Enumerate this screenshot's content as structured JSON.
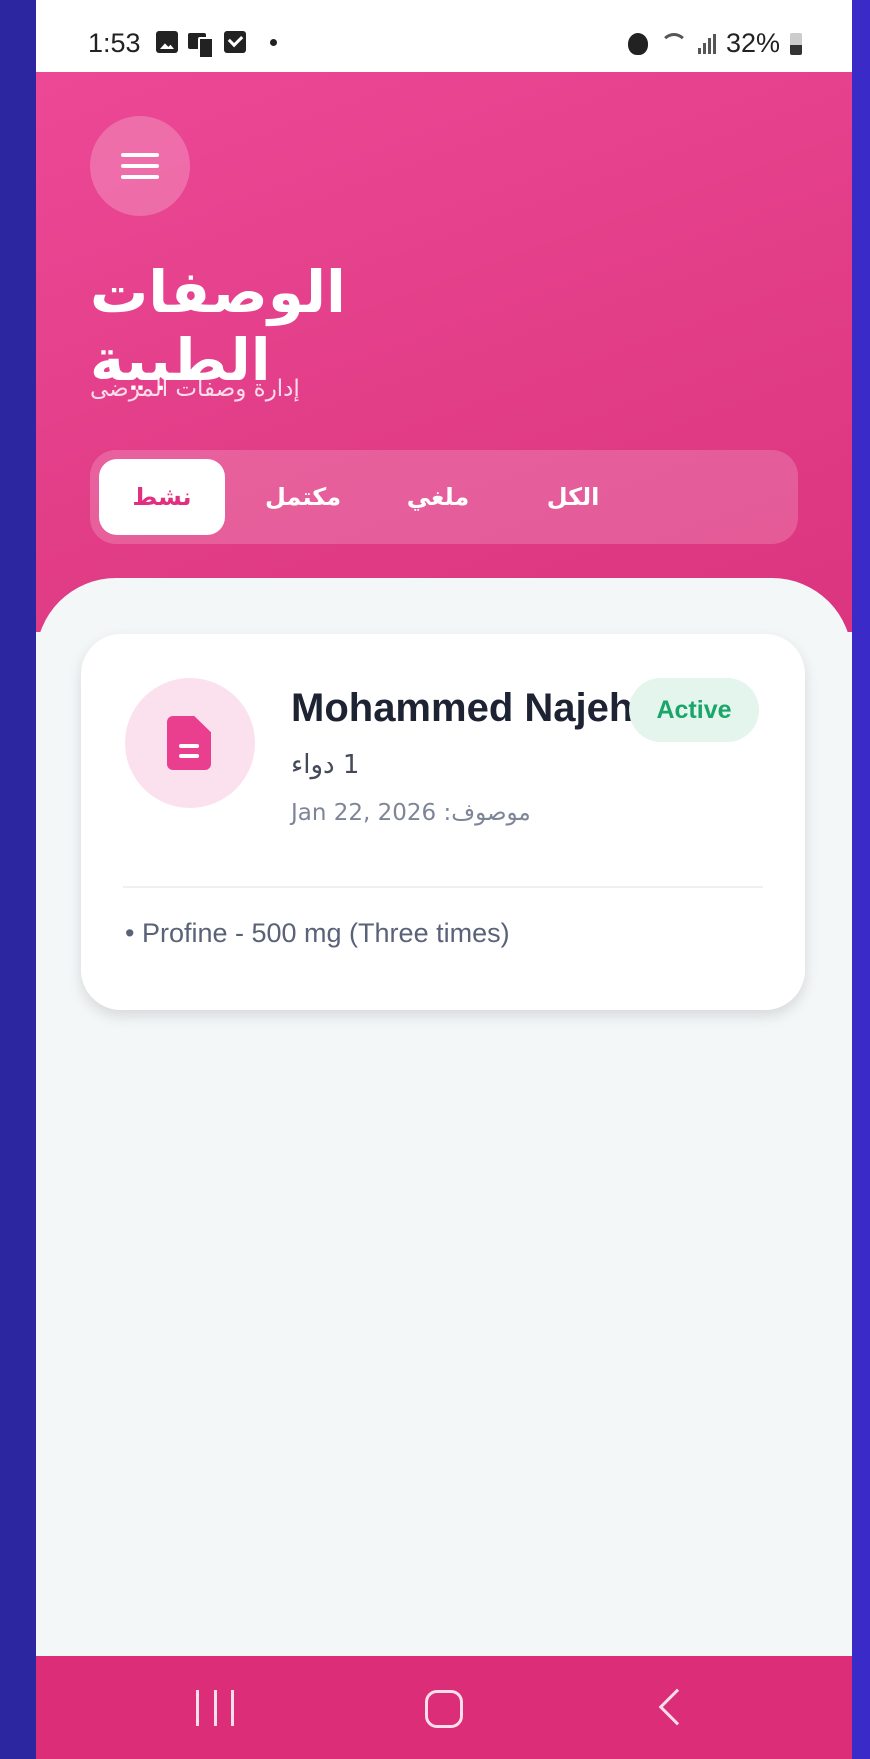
{
  "status_bar": {
    "time": "1:53",
    "battery": "32%",
    "icons": [
      "photo-icon",
      "device-icon",
      "checkbox-icon",
      "dot-icon",
      "alarm-icon",
      "wifi-icon",
      "signal-icon",
      "battery-icon"
    ]
  },
  "header": {
    "title": "الوصفات الطبية",
    "subtitle": "إدارة وصفات المرضى",
    "menu_icon": "hamburger-menu-icon",
    "accent_color": "#e23d87"
  },
  "tabs": [
    {
      "label": "نشط",
      "active": true
    },
    {
      "label": "مكتمل",
      "active": false
    },
    {
      "label": "ملغي",
      "active": false
    },
    {
      "label": "الكل",
      "active": false
    }
  ],
  "prescriptions": [
    {
      "patient_name": "Mohammed Najeh",
      "status": "Active",
      "status_color": "#1aa56b",
      "medication_count": "1 دواء",
      "prescribed": "موصوف: Jan 22, 2026",
      "medications": [
        "• Profine - 500 mg (Three times)"
      ],
      "icon": "document-icon"
    }
  ],
  "nav_bar": {
    "icons": [
      "recents-icon",
      "home-icon",
      "back-icon"
    ]
  }
}
